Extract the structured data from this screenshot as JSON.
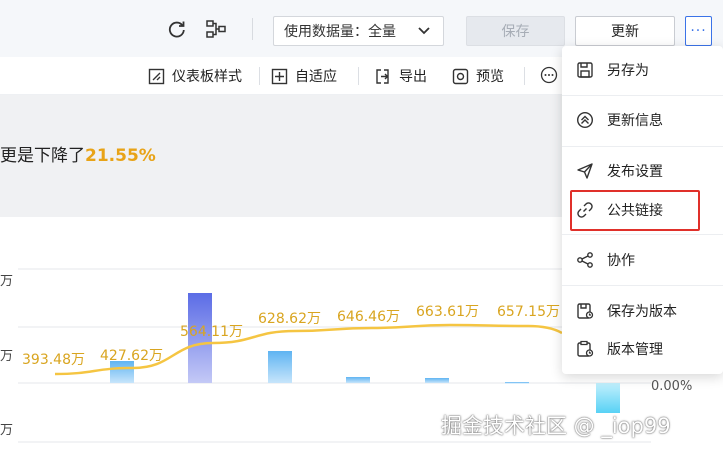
{
  "toolbar": {
    "dataset_label": "使用数据量：全量",
    "save_label": "保存",
    "update_label": "更新",
    "more_label": "···"
  },
  "subtoolbar": {
    "items": [
      {
        "label": "仪表板样式",
        "icon": "dashboard-style-icon"
      },
      {
        "label": "自适应",
        "icon": "adaptive-icon"
      },
      {
        "label": "导出",
        "icon": "export-icon"
      },
      {
        "label": "预览",
        "icon": "preview-icon"
      }
    ]
  },
  "summary": {
    "prefix": "更是下降了",
    "highlight": "21.55%"
  },
  "menu": {
    "items": [
      {
        "label": "另存为",
        "icon": "save-as-icon"
      },
      {
        "label": "更新信息",
        "icon": "update-info-icon"
      },
      {
        "label": "发布设置",
        "icon": "publish-icon"
      },
      {
        "label": "公共链接",
        "icon": "link-icon"
      },
      {
        "label": "协作",
        "icon": "share-icon"
      },
      {
        "label": "保存为版本",
        "icon": "save-version-icon"
      },
      {
        "label": "版本管理",
        "icon": "version-manage-icon"
      }
    ]
  },
  "chart_data": {
    "type": "bar",
    "yticks": [
      "万",
      "万",
      "万"
    ],
    "line_labels": [
      "393.48万",
      "427.62万",
      "564.11万",
      "628.62万",
      "646.46万",
      "663.61万",
      "657.15万"
    ],
    "line_values": [
      393.48,
      427.62,
      564.11,
      628.62,
      646.46,
      663.61,
      657.15
    ],
    "bar_values": [
      22,
      90,
      32,
      6,
      5,
      1,
      -30
    ],
    "right_label": "0.00%"
  },
  "watermark": "掘金技术社区 @ _iop99"
}
